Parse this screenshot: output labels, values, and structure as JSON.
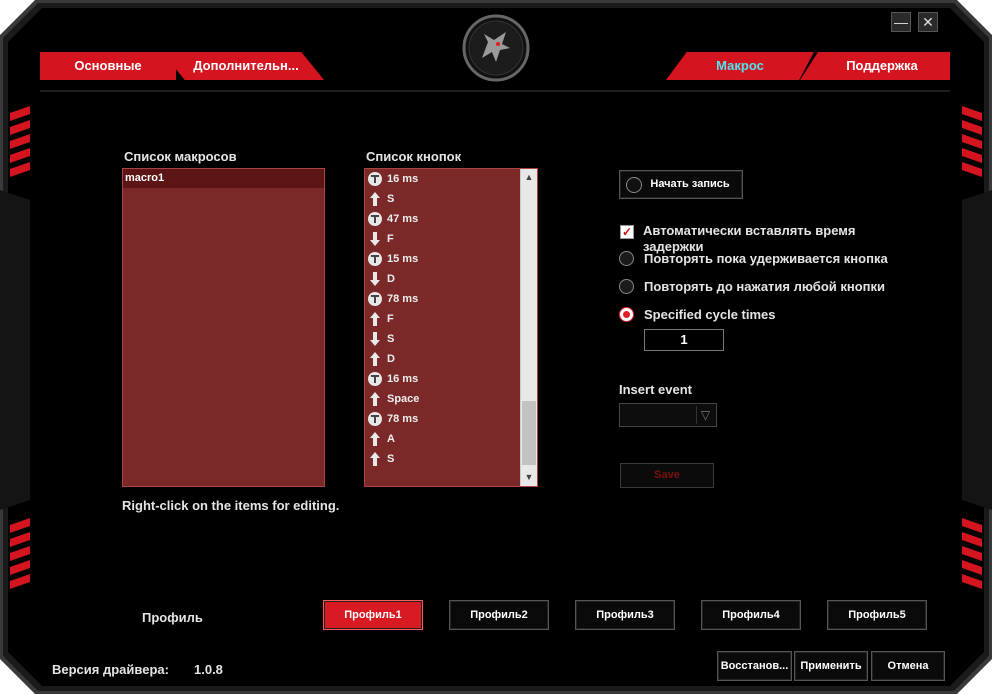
{
  "window": {
    "minimize_label": "—",
    "close_label": "✕",
    "logo_icon": "dragon-logo-icon"
  },
  "tabs": [
    {
      "label": "Основные"
    },
    {
      "label": "Дополнительн..."
    },
    {
      "label": "Макрос"
    },
    {
      "label": "Поддержка"
    }
  ],
  "macro_list": {
    "title": "Список макросов",
    "items": [
      "macro1"
    ]
  },
  "key_list": {
    "title": "Список кнопок",
    "items": [
      {
        "icon": "timer-icon",
        "text": "16 ms"
      },
      {
        "icon": "key-up-icon",
        "text": "S"
      },
      {
        "icon": "timer-icon",
        "text": "47 ms"
      },
      {
        "icon": "key-down-icon",
        "text": "F"
      },
      {
        "icon": "timer-icon",
        "text": "15 ms"
      },
      {
        "icon": "key-down-icon",
        "text": "D"
      },
      {
        "icon": "timer-icon",
        "text": "78 ms"
      },
      {
        "icon": "key-up-icon",
        "text": "F"
      },
      {
        "icon": "key-down-icon",
        "text": "S"
      },
      {
        "icon": "key-up-icon",
        "text": "D"
      },
      {
        "icon": "timer-icon",
        "text": "16 ms"
      },
      {
        "icon": "key-up-icon",
        "text": "Space"
      },
      {
        "icon": "timer-icon",
        "text": "78 ms"
      },
      {
        "icon": "key-up-icon",
        "text": "A"
      },
      {
        "icon": "key-up-icon",
        "text": "S"
      }
    ]
  },
  "hint": "Right-click on the items for editing.",
  "record": {
    "label": "Начать запись"
  },
  "options": {
    "auto_delay": {
      "label": "Автоматически вставлять время задержки",
      "checked": true
    },
    "repeat_hold": {
      "label": "Повторять пока удерживается кнопка",
      "selected": false
    },
    "repeat_until": {
      "label": "Повторять до нажатия любой кнопки",
      "selected": false
    },
    "cycle": {
      "label": "Specified cycle times",
      "selected": true,
      "value": "1"
    }
  },
  "insert_event": {
    "label": "Insert event",
    "value": ""
  },
  "save": {
    "label": "Save"
  },
  "profiles": {
    "label": "Профиль",
    "items": [
      "Профиль1",
      "Профиль2",
      "Профиль3",
      "Профиль4",
      "Профиль5"
    ],
    "active_index": 0
  },
  "driver": {
    "label": "Версия драйвера:",
    "version": "1.0.8"
  },
  "buttons": {
    "restore": "Восстанов...",
    "apply": "Применить",
    "cancel": "Отмена"
  },
  "colors": {
    "accent": "#d4141e",
    "active_tab_text": "#4ee4f0",
    "list_bg": "#7b2828"
  }
}
